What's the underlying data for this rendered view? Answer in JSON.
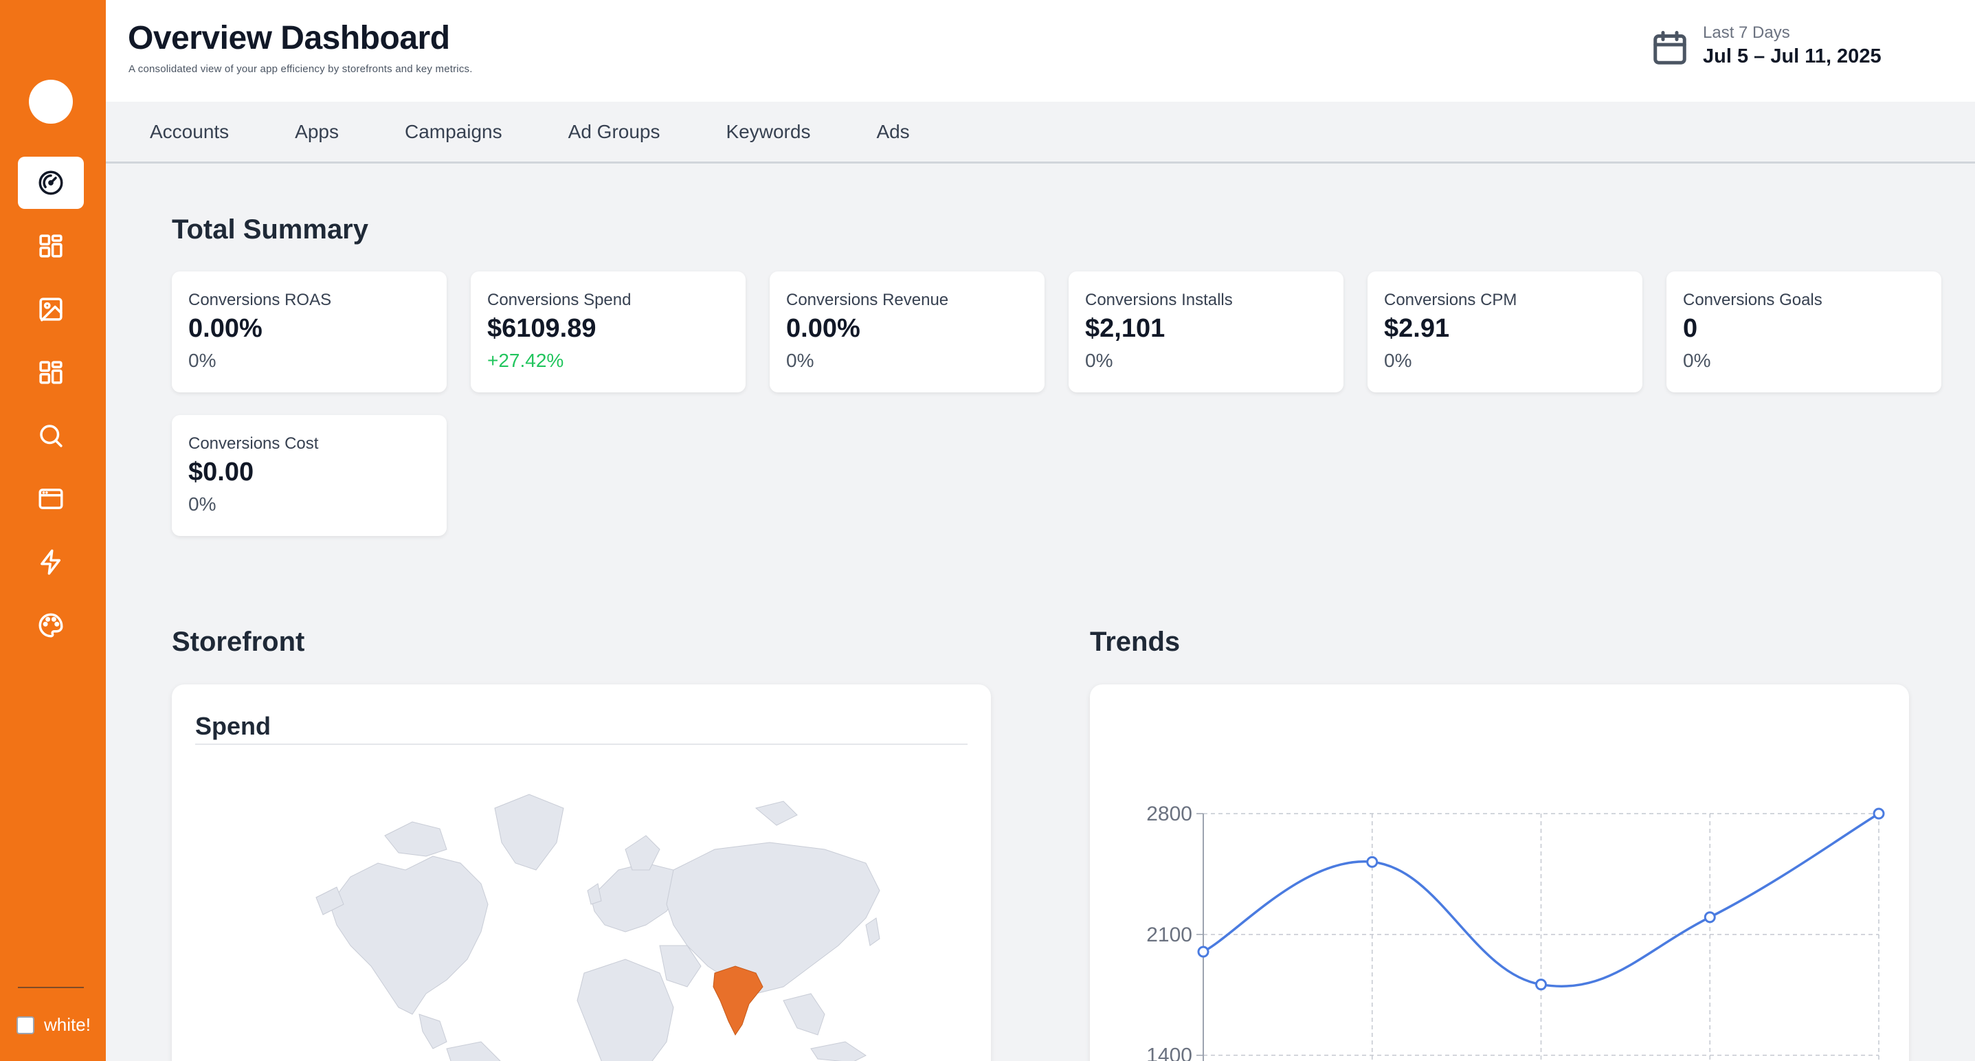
{
  "header": {
    "title": "Overview Dashboard",
    "subtitle": "A consolidated view of your app efficiency by storefronts and key metrics.",
    "date_range_label": "Last 7 Days",
    "date_range_value": "Jul 5 – Jul 11, 2025"
  },
  "sidebar": {
    "items": [
      {
        "icon": "gauge-icon",
        "active": true
      },
      {
        "icon": "grid-icon",
        "active": false
      },
      {
        "icon": "image-icon",
        "active": false
      },
      {
        "icon": "grid-icon",
        "active": false
      },
      {
        "icon": "search-icon",
        "active": false
      },
      {
        "icon": "browser-window-icon",
        "active": false
      },
      {
        "icon": "lightning-icon",
        "active": false
      },
      {
        "icon": "palette-icon",
        "active": false
      }
    ],
    "toggle_label": "white!"
  },
  "tabs": [
    "Accounts",
    "Apps",
    "Campaigns",
    "Ad Groups",
    "Keywords",
    "Ads"
  ],
  "summary": {
    "title": "Total Summary",
    "cards": [
      {
        "label": "Conversions ROAS",
        "value": "0.00%",
        "delta": "0%"
      },
      {
        "label": "Conversions Spend",
        "value": "$6109.89",
        "delta": "+27.42%",
        "delta_color": "#22c55e"
      },
      {
        "label": "Conversions Revenue",
        "value": "0.00%",
        "delta": "0%"
      },
      {
        "label": "Conversions Installs",
        "value": "$2,101",
        "delta": "0%"
      },
      {
        "label": "Conversions CPM",
        "value": "$2.91",
        "delta": "0%"
      },
      {
        "label": "Conversions Goals",
        "value": "0",
        "delta": "0%"
      },
      {
        "label": "Conversions Cost",
        "value": "$0.00",
        "delta": "0%"
      }
    ]
  },
  "storefront": {
    "title": "Storefront",
    "panel_title": "Spend",
    "highlight_region": "India",
    "highlight_color": "#e8702a",
    "land_color": "#e3e6ed"
  },
  "trends": {
    "title": "Trends"
  },
  "colors": {
    "accent": "#f27316",
    "line": "#4a7be0",
    "positive": "#22c55e"
  },
  "chart_data": {
    "type": "line",
    "series": [
      {
        "values": [
          2000,
          2520,
          1810,
          2200,
          2800
        ]
      }
    ],
    "ylim": [
      1120,
      2800
    ],
    "yticks": [
      2800,
      2100,
      1400
    ],
    "grid": true,
    "smooth": true
  }
}
